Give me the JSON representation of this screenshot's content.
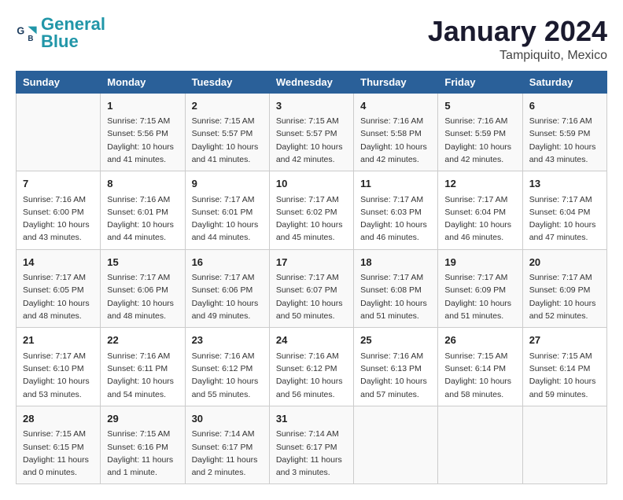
{
  "logo": {
    "general": "General",
    "blue": "Blue"
  },
  "title": "January 2024",
  "location": "Tampiquito, Mexico",
  "days_of_week": [
    "Sunday",
    "Monday",
    "Tuesday",
    "Wednesday",
    "Thursday",
    "Friday",
    "Saturday"
  ],
  "weeks": [
    [
      {
        "day": "",
        "info": ""
      },
      {
        "day": "1",
        "info": "Sunrise: 7:15 AM\nSunset: 5:56 PM\nDaylight: 10 hours\nand 41 minutes."
      },
      {
        "day": "2",
        "info": "Sunrise: 7:15 AM\nSunset: 5:57 PM\nDaylight: 10 hours\nand 41 minutes."
      },
      {
        "day": "3",
        "info": "Sunrise: 7:15 AM\nSunset: 5:57 PM\nDaylight: 10 hours\nand 42 minutes."
      },
      {
        "day": "4",
        "info": "Sunrise: 7:16 AM\nSunset: 5:58 PM\nDaylight: 10 hours\nand 42 minutes."
      },
      {
        "day": "5",
        "info": "Sunrise: 7:16 AM\nSunset: 5:59 PM\nDaylight: 10 hours\nand 42 minutes."
      },
      {
        "day": "6",
        "info": "Sunrise: 7:16 AM\nSunset: 5:59 PM\nDaylight: 10 hours\nand 43 minutes."
      }
    ],
    [
      {
        "day": "7",
        "info": "Sunrise: 7:16 AM\nSunset: 6:00 PM\nDaylight: 10 hours\nand 43 minutes."
      },
      {
        "day": "8",
        "info": "Sunrise: 7:16 AM\nSunset: 6:01 PM\nDaylight: 10 hours\nand 44 minutes."
      },
      {
        "day": "9",
        "info": "Sunrise: 7:17 AM\nSunset: 6:01 PM\nDaylight: 10 hours\nand 44 minutes."
      },
      {
        "day": "10",
        "info": "Sunrise: 7:17 AM\nSunset: 6:02 PM\nDaylight: 10 hours\nand 45 minutes."
      },
      {
        "day": "11",
        "info": "Sunrise: 7:17 AM\nSunset: 6:03 PM\nDaylight: 10 hours\nand 46 minutes."
      },
      {
        "day": "12",
        "info": "Sunrise: 7:17 AM\nSunset: 6:04 PM\nDaylight: 10 hours\nand 46 minutes."
      },
      {
        "day": "13",
        "info": "Sunrise: 7:17 AM\nSunset: 6:04 PM\nDaylight: 10 hours\nand 47 minutes."
      }
    ],
    [
      {
        "day": "14",
        "info": "Sunrise: 7:17 AM\nSunset: 6:05 PM\nDaylight: 10 hours\nand 48 minutes."
      },
      {
        "day": "15",
        "info": "Sunrise: 7:17 AM\nSunset: 6:06 PM\nDaylight: 10 hours\nand 48 minutes."
      },
      {
        "day": "16",
        "info": "Sunrise: 7:17 AM\nSunset: 6:06 PM\nDaylight: 10 hours\nand 49 minutes."
      },
      {
        "day": "17",
        "info": "Sunrise: 7:17 AM\nSunset: 6:07 PM\nDaylight: 10 hours\nand 50 minutes."
      },
      {
        "day": "18",
        "info": "Sunrise: 7:17 AM\nSunset: 6:08 PM\nDaylight: 10 hours\nand 51 minutes."
      },
      {
        "day": "19",
        "info": "Sunrise: 7:17 AM\nSunset: 6:09 PM\nDaylight: 10 hours\nand 51 minutes."
      },
      {
        "day": "20",
        "info": "Sunrise: 7:17 AM\nSunset: 6:09 PM\nDaylight: 10 hours\nand 52 minutes."
      }
    ],
    [
      {
        "day": "21",
        "info": "Sunrise: 7:17 AM\nSunset: 6:10 PM\nDaylight: 10 hours\nand 53 minutes."
      },
      {
        "day": "22",
        "info": "Sunrise: 7:16 AM\nSunset: 6:11 PM\nDaylight: 10 hours\nand 54 minutes."
      },
      {
        "day": "23",
        "info": "Sunrise: 7:16 AM\nSunset: 6:12 PM\nDaylight: 10 hours\nand 55 minutes."
      },
      {
        "day": "24",
        "info": "Sunrise: 7:16 AM\nSunset: 6:12 PM\nDaylight: 10 hours\nand 56 minutes."
      },
      {
        "day": "25",
        "info": "Sunrise: 7:16 AM\nSunset: 6:13 PM\nDaylight: 10 hours\nand 57 minutes."
      },
      {
        "day": "26",
        "info": "Sunrise: 7:15 AM\nSunset: 6:14 PM\nDaylight: 10 hours\nand 58 minutes."
      },
      {
        "day": "27",
        "info": "Sunrise: 7:15 AM\nSunset: 6:14 PM\nDaylight: 10 hours\nand 59 minutes."
      }
    ],
    [
      {
        "day": "28",
        "info": "Sunrise: 7:15 AM\nSunset: 6:15 PM\nDaylight: 11 hours\nand 0 minutes."
      },
      {
        "day": "29",
        "info": "Sunrise: 7:15 AM\nSunset: 6:16 PM\nDaylight: 11 hours\nand 1 minute."
      },
      {
        "day": "30",
        "info": "Sunrise: 7:14 AM\nSunset: 6:17 PM\nDaylight: 11 hours\nand 2 minutes."
      },
      {
        "day": "31",
        "info": "Sunrise: 7:14 AM\nSunset: 6:17 PM\nDaylight: 11 hours\nand 3 minutes."
      },
      {
        "day": "",
        "info": ""
      },
      {
        "day": "",
        "info": ""
      },
      {
        "day": "",
        "info": ""
      }
    ]
  ]
}
